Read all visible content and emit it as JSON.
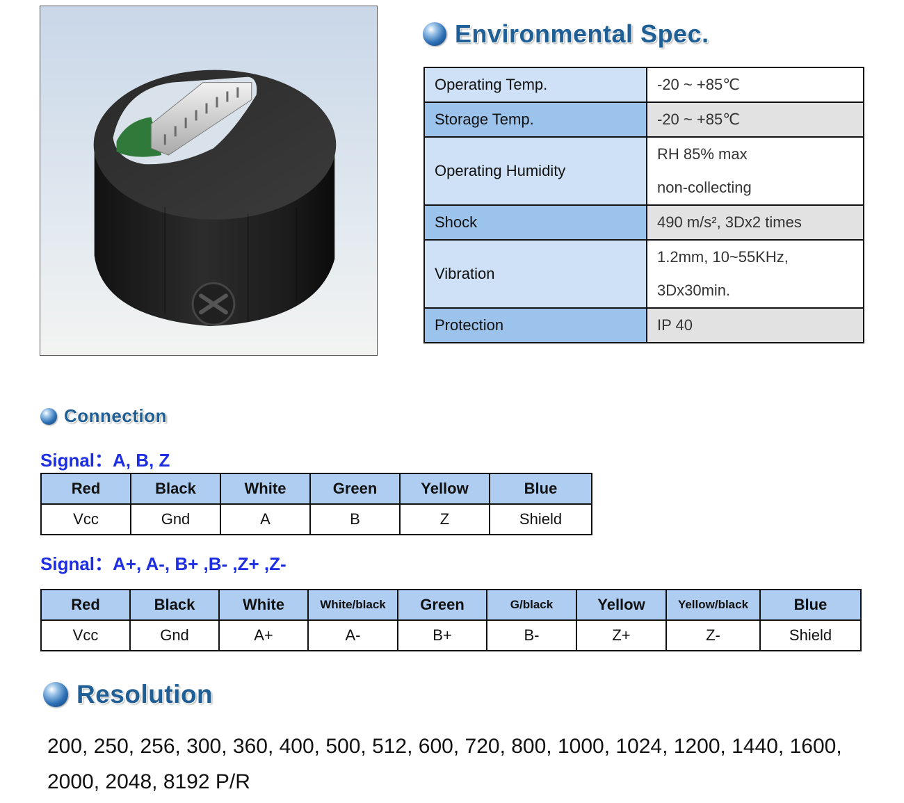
{
  "product_image": {
    "icon": "encoder-housing-photo"
  },
  "environmental": {
    "title": "Environmental Spec.",
    "rows": [
      {
        "label": "Operating Temp.",
        "value": [
          "-20 ~ +85℃"
        ]
      },
      {
        "label": "Storage Temp.",
        "value": [
          "-20 ~ +85℃"
        ]
      },
      {
        "label": "Operating Humidity",
        "value": [
          "RH 85% max",
          "non-collecting"
        ]
      },
      {
        "label": "Shock",
        "value": [
          "490 m/s², 3Dx2 times"
        ]
      },
      {
        "label": "Vibration",
        "value": [
          "1.2mm, 10~55KHz,",
          "3Dx30min."
        ]
      },
      {
        "label": "Protection",
        "value": [
          "IP 40"
        ]
      }
    ]
  },
  "connection": {
    "title": "Connection",
    "signal1": {
      "label": "Signal：A, B, Z",
      "headers": [
        "Red",
        "Black",
        "White",
        "Green",
        "Yellow",
        "Blue"
      ],
      "values": [
        "Vcc",
        "Gnd",
        "A",
        "B",
        "Z",
        "Shield"
      ]
    },
    "signal2": {
      "label": "Signal：A+, A-, B+ ,B- ,Z+ ,Z-",
      "headers": [
        "Red",
        "Black",
        "White",
        "White/black",
        "Green",
        "G/black",
        "Yellow",
        "Yellow/black",
        "Blue"
      ],
      "values": [
        "Vcc",
        "Gnd",
        "A+",
        "A-",
        "B+",
        "B-",
        "Z+",
        "Z-",
        "Shield"
      ]
    }
  },
  "resolution": {
    "title": "Resolution",
    "line1": "200, 250, 256, 300, 360, 400, 500, 512, 600, 720, 800, 1000, 1024, 1200, 1440, 1600,",
    "line2": "2000, 2048, 8192 P/R"
  },
  "colors": {
    "title_blue": "#1f5f95",
    "signal_blue": "#1d2ee3",
    "header_light": "#cfe1f6",
    "header_dark": "#9cc3ec",
    "wire_header": "#aecdf1"
  }
}
